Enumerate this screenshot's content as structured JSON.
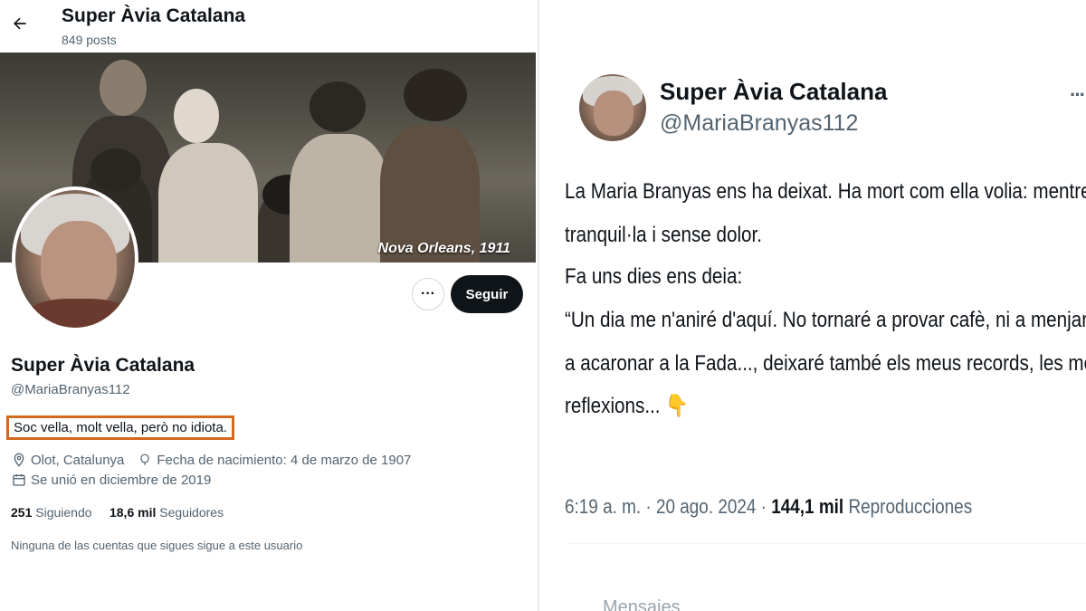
{
  "profile_header": {
    "title": "Super Àvia Catalana",
    "posts_count": "849 posts",
    "back_icon": "arrow-left-icon"
  },
  "banner": {
    "caption": "Nova Orleans, 1911"
  },
  "actions": {
    "more_icon": "···",
    "follow_label": "Seguir"
  },
  "profile": {
    "name": "Super Àvia Catalana",
    "handle": "@MariaBranyas112",
    "bio": "Soc vella, molt vella, però no idiota.",
    "location": "Olot, Catalunya",
    "birthdate": "Fecha de nacimiento: 4 de marzo de 1907",
    "joined": "Se unió en diciembre de 2019",
    "following_count": "251",
    "following_label": "Siguiendo",
    "followers_count": "18,6 mil",
    "followers_label": "Seguidores",
    "note": "Ninguna de las cuentas que sigues sigue a este usuario"
  },
  "tweet": {
    "author_name": "Super Àvia Catalana",
    "author_handle": "@MariaBranyas112",
    "more_icon": "···",
    "lines": [
      "La Maria Branyas ens ha deixat. Ha mort com ella volia: mentre dormia,",
      "tranquil·la i sense dolor.",
      "Fa uns dies ens deia:",
      "“Un dia me n'aniré d'aquí. No tornaré a provar cafè, ni a menjar iogurt, ni",
      "a acaronar a la Fada..., deixaré també els meus records, les meves",
      "reflexions... 👇"
    ],
    "time": "6:19 a. m. · 20 ago. 2024 · ",
    "views_count": "144,1 mil",
    "views_label": "Reproducciones",
    "footer_partial": "Mensajes"
  },
  "colors": {
    "bio_highlight_border": "#d2691e",
    "follow_button_bg": "#0f1419",
    "secondary_text": "#536471"
  }
}
